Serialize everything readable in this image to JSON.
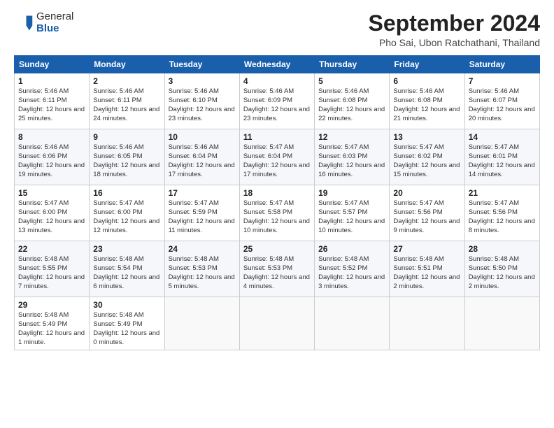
{
  "header": {
    "logo_general": "General",
    "logo_blue": "Blue",
    "title": "September 2024",
    "location": "Pho Sai, Ubon Ratchathani, Thailand"
  },
  "days_of_week": [
    "Sunday",
    "Monday",
    "Tuesday",
    "Wednesday",
    "Thursday",
    "Friday",
    "Saturday"
  ],
  "weeks": [
    [
      {
        "day": "1",
        "sunrise": "5:46 AM",
        "sunset": "6:11 PM",
        "daylight": "12 hours and 25 minutes."
      },
      {
        "day": "2",
        "sunrise": "5:46 AM",
        "sunset": "6:11 PM",
        "daylight": "12 hours and 24 minutes."
      },
      {
        "day": "3",
        "sunrise": "5:46 AM",
        "sunset": "6:10 PM",
        "daylight": "12 hours and 23 minutes."
      },
      {
        "day": "4",
        "sunrise": "5:46 AM",
        "sunset": "6:09 PM",
        "daylight": "12 hours and 23 minutes."
      },
      {
        "day": "5",
        "sunrise": "5:46 AM",
        "sunset": "6:08 PM",
        "daylight": "12 hours and 22 minutes."
      },
      {
        "day": "6",
        "sunrise": "5:46 AM",
        "sunset": "6:08 PM",
        "daylight": "12 hours and 21 minutes."
      },
      {
        "day": "7",
        "sunrise": "5:46 AM",
        "sunset": "6:07 PM",
        "daylight": "12 hours and 20 minutes."
      }
    ],
    [
      {
        "day": "8",
        "sunrise": "5:46 AM",
        "sunset": "6:06 PM",
        "daylight": "12 hours and 19 minutes."
      },
      {
        "day": "9",
        "sunrise": "5:46 AM",
        "sunset": "6:05 PM",
        "daylight": "12 hours and 18 minutes."
      },
      {
        "day": "10",
        "sunrise": "5:46 AM",
        "sunset": "6:04 PM",
        "daylight": "12 hours and 17 minutes."
      },
      {
        "day": "11",
        "sunrise": "5:47 AM",
        "sunset": "6:04 PM",
        "daylight": "12 hours and 17 minutes."
      },
      {
        "day": "12",
        "sunrise": "5:47 AM",
        "sunset": "6:03 PM",
        "daylight": "12 hours and 16 minutes."
      },
      {
        "day": "13",
        "sunrise": "5:47 AM",
        "sunset": "6:02 PM",
        "daylight": "12 hours and 15 minutes."
      },
      {
        "day": "14",
        "sunrise": "5:47 AM",
        "sunset": "6:01 PM",
        "daylight": "12 hours and 14 minutes."
      }
    ],
    [
      {
        "day": "15",
        "sunrise": "5:47 AM",
        "sunset": "6:00 PM",
        "daylight": "12 hours and 13 minutes."
      },
      {
        "day": "16",
        "sunrise": "5:47 AM",
        "sunset": "6:00 PM",
        "daylight": "12 hours and 12 minutes."
      },
      {
        "day": "17",
        "sunrise": "5:47 AM",
        "sunset": "5:59 PM",
        "daylight": "12 hours and 11 minutes."
      },
      {
        "day": "18",
        "sunrise": "5:47 AM",
        "sunset": "5:58 PM",
        "daylight": "12 hours and 10 minutes."
      },
      {
        "day": "19",
        "sunrise": "5:47 AM",
        "sunset": "5:57 PM",
        "daylight": "12 hours and 10 minutes."
      },
      {
        "day": "20",
        "sunrise": "5:47 AM",
        "sunset": "5:56 PM",
        "daylight": "12 hours and 9 minutes."
      },
      {
        "day": "21",
        "sunrise": "5:47 AM",
        "sunset": "5:56 PM",
        "daylight": "12 hours and 8 minutes."
      }
    ],
    [
      {
        "day": "22",
        "sunrise": "5:48 AM",
        "sunset": "5:55 PM",
        "daylight": "12 hours and 7 minutes."
      },
      {
        "day": "23",
        "sunrise": "5:48 AM",
        "sunset": "5:54 PM",
        "daylight": "12 hours and 6 minutes."
      },
      {
        "day": "24",
        "sunrise": "5:48 AM",
        "sunset": "5:53 PM",
        "daylight": "12 hours and 5 minutes."
      },
      {
        "day": "25",
        "sunrise": "5:48 AM",
        "sunset": "5:53 PM",
        "daylight": "12 hours and 4 minutes."
      },
      {
        "day": "26",
        "sunrise": "5:48 AM",
        "sunset": "5:52 PM",
        "daylight": "12 hours and 3 minutes."
      },
      {
        "day": "27",
        "sunrise": "5:48 AM",
        "sunset": "5:51 PM",
        "daylight": "12 hours and 2 minutes."
      },
      {
        "day": "28",
        "sunrise": "5:48 AM",
        "sunset": "5:50 PM",
        "daylight": "12 hours and 2 minutes."
      }
    ],
    [
      {
        "day": "29",
        "sunrise": "5:48 AM",
        "sunset": "5:49 PM",
        "daylight": "12 hours and 1 minute."
      },
      {
        "day": "30",
        "sunrise": "5:48 AM",
        "sunset": "5:49 PM",
        "daylight": "12 hours and 0 minutes."
      },
      null,
      null,
      null,
      null,
      null
    ]
  ]
}
